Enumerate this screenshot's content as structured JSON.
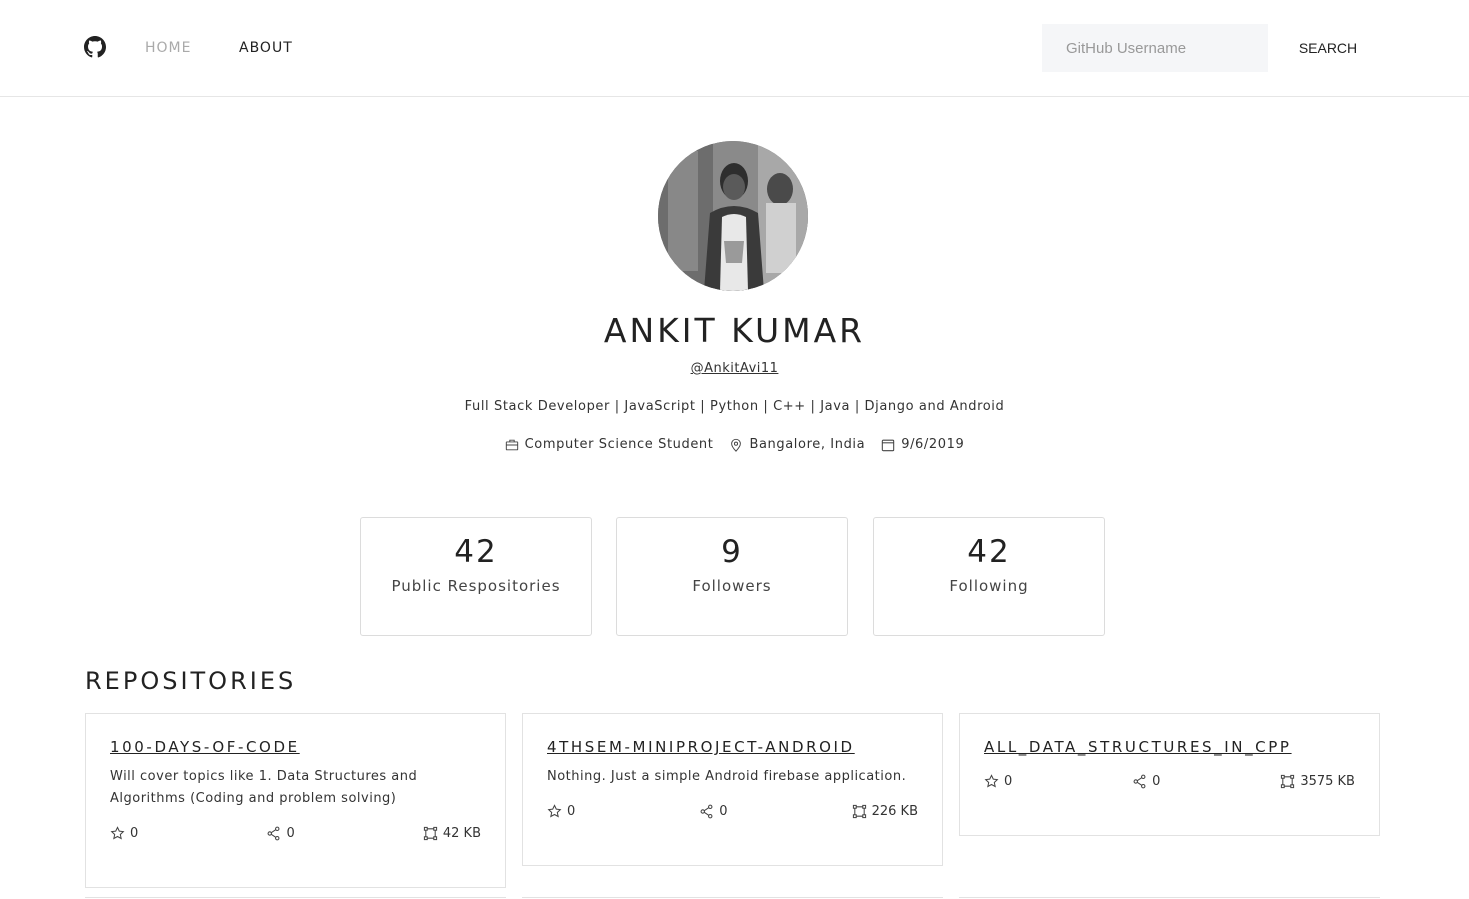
{
  "nav": {
    "home_label": "HOME",
    "about_label": "ABOUT",
    "search_placeholder": "GitHub Username",
    "search_label": "SEARCH"
  },
  "profile": {
    "name": "ANKIT KUMAR",
    "login": "@AnkitAvi11",
    "bio": "Full Stack Developer | JavaScript | Python | C++ | Java | Django and Android",
    "company": "Computer Science Student",
    "location": "Bangalore, India",
    "joined": "9/6/2019"
  },
  "stats": [
    {
      "value": "42",
      "label": "Public Respositories"
    },
    {
      "value": "9",
      "label": "Followers"
    },
    {
      "value": "42",
      "label": "Following"
    }
  ],
  "repos_heading": "REPOSITORIES",
  "repos": [
    {
      "name": "100-DAYS-OF-CODE",
      "description": "Will cover topics like 1. Data Structures and Algorithms (Coding and problem solving)",
      "stars": "0",
      "forks": "0",
      "size": "42 KB"
    },
    {
      "name": "4THSEM-MINIPROJECT-ANDROID",
      "description": "Nothing. Just a simple Android firebase application.",
      "stars": "0",
      "forks": "0",
      "size": "226 KB"
    },
    {
      "name": "ALL_DATA_STRUCTURES_IN_CPP",
      "description": "",
      "stars": "0",
      "forks": "0",
      "size": "3575 KB"
    }
  ],
  "icons": {
    "logo": "github-icon",
    "company": "briefcase-icon",
    "location": "map-pin-icon",
    "joined": "calendar-icon",
    "stars": "star-icon",
    "forks": "share-icon",
    "size": "size-icon"
  }
}
